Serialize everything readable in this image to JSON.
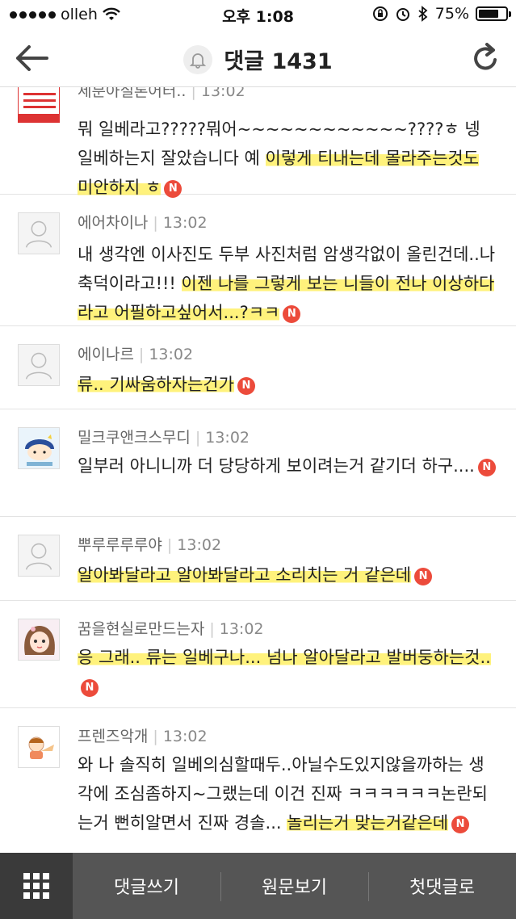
{
  "status_bar": {
    "carrier": "olleh",
    "time": "오후 1:08",
    "battery": "75%",
    "battery_level": 0.75
  },
  "nav": {
    "title": "댓글 1431"
  },
  "comments": [
    {
      "author": "세분아질론어터..",
      "time": "13:02",
      "text_plain": "뭐 일베라고?????뭐어~~~~~~~~~~~~????ㅎ 넹 일베하는지 잘았습니다 예 ",
      "text_highlight": "이렇게 티내는데 몰라주는것도 미안하지 ㅎ",
      "avatar": "poster"
    },
    {
      "author": "에어차이나",
      "time": "13:02",
      "text_plain": "내 생각엔 이사진도 두부 사진처럼 암생각없이 올린건데..나 축덕이라고!!! ",
      "text_highlight": "이젠 나를 그렇게 보는 니들이 전나 이상하다 라고 어필하고싶어서...?ㅋㅋ",
      "avatar": "default"
    },
    {
      "author": "에이나르",
      "time": "13:02",
      "text_plain": "",
      "text_highlight": "류.. 기싸움하자는건가",
      "avatar": "default"
    },
    {
      "author": "밀크쿠앤크스무디",
      "time": "13:02",
      "text_plain": "일부러 아니니까 더 당당하게 보이려는거 같기더 하구....",
      "text_highlight": "",
      "avatar": "character-blue"
    },
    {
      "author": "뿌루루루루야",
      "time": "13:02",
      "text_plain": "",
      "text_highlight": "알아봐달라고 알아봐달라고 소리치는 거 같은데",
      "avatar": "default"
    },
    {
      "author": "꿈을현실로만드는자",
      "time": "13:02",
      "text_plain": "",
      "text_highlight": "응 그래.. 류는 일베구나... 넘나 알아달라고 발버둥하는것..",
      "avatar": "character-girl"
    },
    {
      "author": "프렌즈악개",
      "time": "13:02",
      "text_plain": "와 나 솔직히 일베의심할때두..아닐수도있지않을까하는 생각에 조심좀하지~그랬는데 이건 진짜 ㅋㅋㅋㅋㅋㅋ논란되는거 뻔히알면서 진짜 경솔... ",
      "text_highlight": "놀리는거 맞는거같은데",
      "avatar": "character-friends"
    }
  ],
  "badge_label": "N",
  "toolbar": {
    "write": "댓글쓰기",
    "original": "원문보기",
    "first": "첫댓글로"
  },
  "colors": {
    "badge": "#ec4b3b",
    "highlight": "#ffee50",
    "toolbar": "#555555"
  }
}
